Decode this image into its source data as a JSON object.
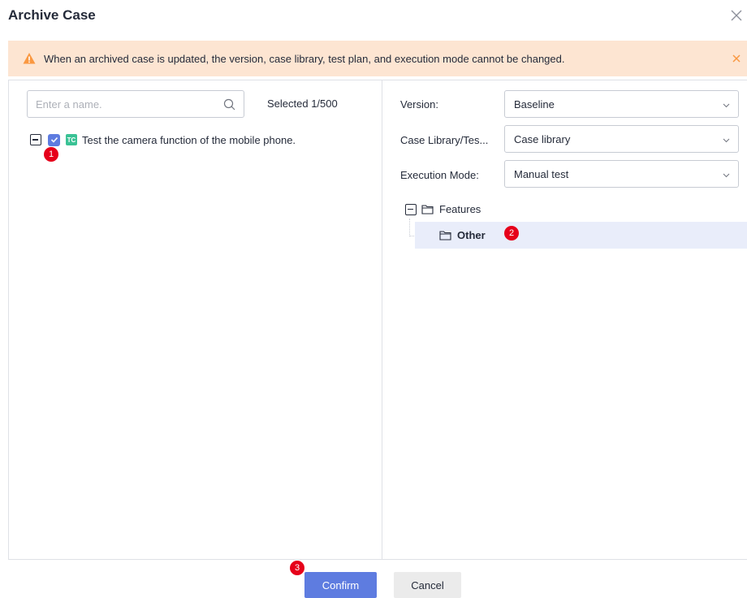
{
  "dialog": {
    "title": "Archive Case"
  },
  "alert": {
    "message": "When an archived case is updated, the version, case library, test plan, and execution mode cannot be changed.",
    "color": "#fde5d2",
    "icon": "warning-icon"
  },
  "left": {
    "search_placeholder": "Enter a name.",
    "selected_text": "Selected 1/500",
    "case": {
      "badge": "TC",
      "label": "Test the camera function of the mobile phone.",
      "checked": true
    }
  },
  "right": {
    "version_label": "Version:",
    "version_value": "Baseline",
    "library_label": "Case Library/Tes...",
    "library_value": "Case library",
    "mode_label": "Execution Mode:",
    "mode_value": "Manual test",
    "tree": {
      "root": "Features",
      "child": "Other"
    }
  },
  "steps": [
    "1",
    "2",
    "3"
  ],
  "footer": {
    "confirm": "Confirm",
    "cancel": "Cancel"
  },
  "colors": {
    "primary": "#5e7ce0",
    "badge_red": "#e6001a",
    "tc_green": "#3ac295",
    "selected_row": "#e9edfa"
  }
}
